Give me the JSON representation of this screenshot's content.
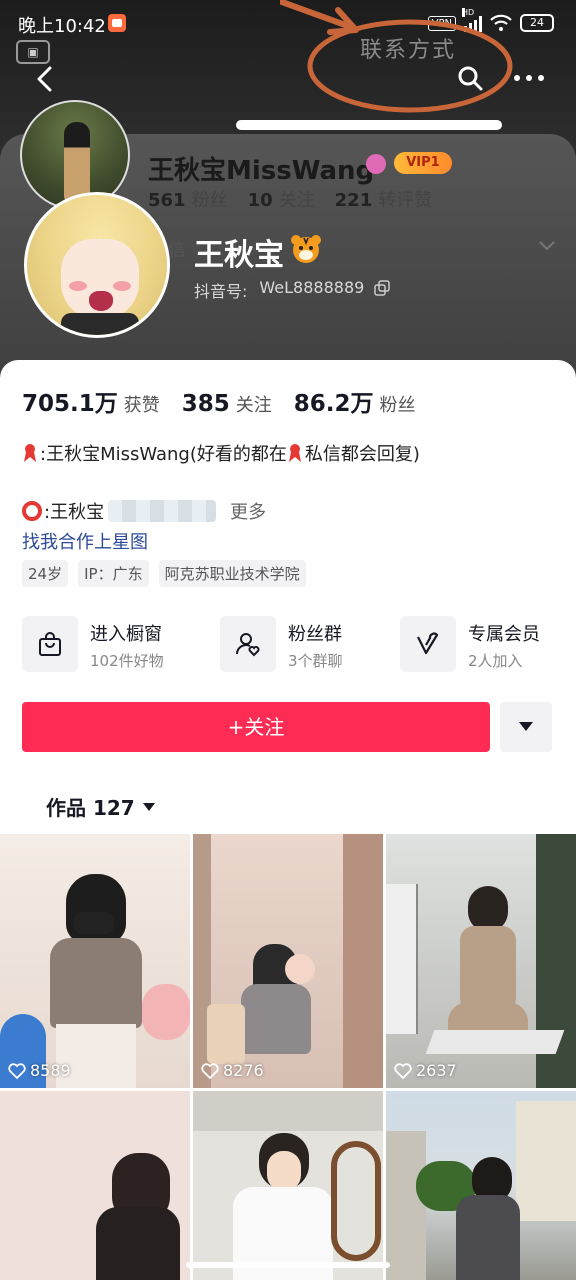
{
  "status_bar": {
    "time": "晚上10:42",
    "vpn": "VPN",
    "hd": "HD",
    "battery": "24"
  },
  "header": {
    "contact_label": "联系方式",
    "ghost_name": "王秋宝MissWang",
    "ghost_vip": "VIP1",
    "ghost_stats": [
      {
        "value": "561",
        "label": "粉丝"
      },
      {
        "value": "10",
        "label": "关注"
      },
      {
        "value": "221",
        "label": "转评赞"
      }
    ],
    "ghost_dm": "私信"
  },
  "profile": {
    "name": "王秋宝",
    "douyin_id_label": "抖音号:",
    "douyin_id": "WeL8888889"
  },
  "stats": [
    {
      "value": "705.1万",
      "label": "获赞"
    },
    {
      "value": "385",
      "label": "关注"
    },
    {
      "value": "86.2万",
      "label": "粉丝"
    }
  ],
  "bio": {
    "line1": ":王秋宝MissWang(好看的都在",
    "line1_tail": "私信都会回复)",
    "line2": ":王秋宝",
    "more": "更多",
    "link": "找我合作上星图"
  },
  "tags": [
    "24岁",
    "IP：广东",
    "阿克苏职业技术学院"
  ],
  "shortcuts": [
    {
      "title": "进入橱窗",
      "subtitle": "102件好物",
      "icon": "shopping-bag-icon"
    },
    {
      "title": "粉丝群",
      "subtitle": "3个群聊",
      "icon": "fan-group-icon"
    },
    {
      "title": "专属会员",
      "subtitle": "2人加入",
      "icon": "membership-v-icon"
    }
  ],
  "follow_button": "+关注",
  "works_tab": "作品 127",
  "videos": [
    {
      "likes": "8589"
    },
    {
      "likes": "8276"
    },
    {
      "likes": "2637"
    }
  ],
  "colors": {
    "accent": "#fe2c55",
    "link": "#2d4a9b",
    "vip": "#ff9a2e"
  }
}
